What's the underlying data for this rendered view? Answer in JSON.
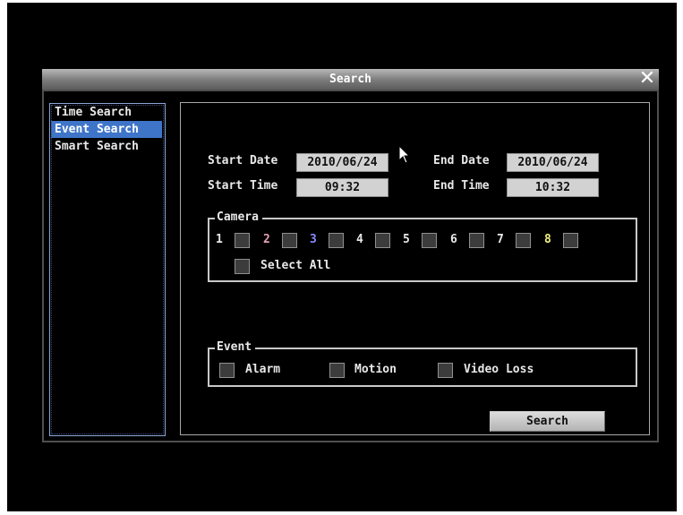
{
  "dialog": {
    "title": "Search",
    "close_icon": "close-icon"
  },
  "sidebar": {
    "items": [
      {
        "label": "Time Search",
        "selected": false
      },
      {
        "label": "Event Search",
        "selected": true
      },
      {
        "label": "Smart Search",
        "selected": false
      }
    ]
  },
  "dates": {
    "start_date_label": "Start Date",
    "start_date_value": "2010/06/24",
    "end_date_label": "End Date",
    "end_date_value": "2010/06/24",
    "start_time_label": "Start Time",
    "start_time_value": "09:32",
    "end_time_label": "End Time",
    "end_time_value": "10:32"
  },
  "camera": {
    "title": "Camera",
    "channels": [
      {
        "label": "1",
        "color": "#e8e8e8"
      },
      {
        "label": "2",
        "color": "#e8a0b8"
      },
      {
        "label": "3",
        "color": "#8a8aff"
      },
      {
        "label": "4",
        "color": "#e8e8e8"
      },
      {
        "label": "5",
        "color": "#e8e8e8"
      },
      {
        "label": "6",
        "color": "#e8e8e8"
      },
      {
        "label": "7",
        "color": "#e8e8e8"
      },
      {
        "label": "8",
        "color": "#f0f080"
      }
    ],
    "select_all_label": "Select All"
  },
  "event": {
    "title": "Event",
    "options": [
      {
        "label": "Alarm"
      },
      {
        "label": "Motion"
      },
      {
        "label": "Video Loss"
      }
    ]
  },
  "search_button_label": "Search",
  "colors": {
    "selected_bg": "#3f75c9",
    "panel_bg": "#000000",
    "field_bg": "#d2d2d2"
  }
}
